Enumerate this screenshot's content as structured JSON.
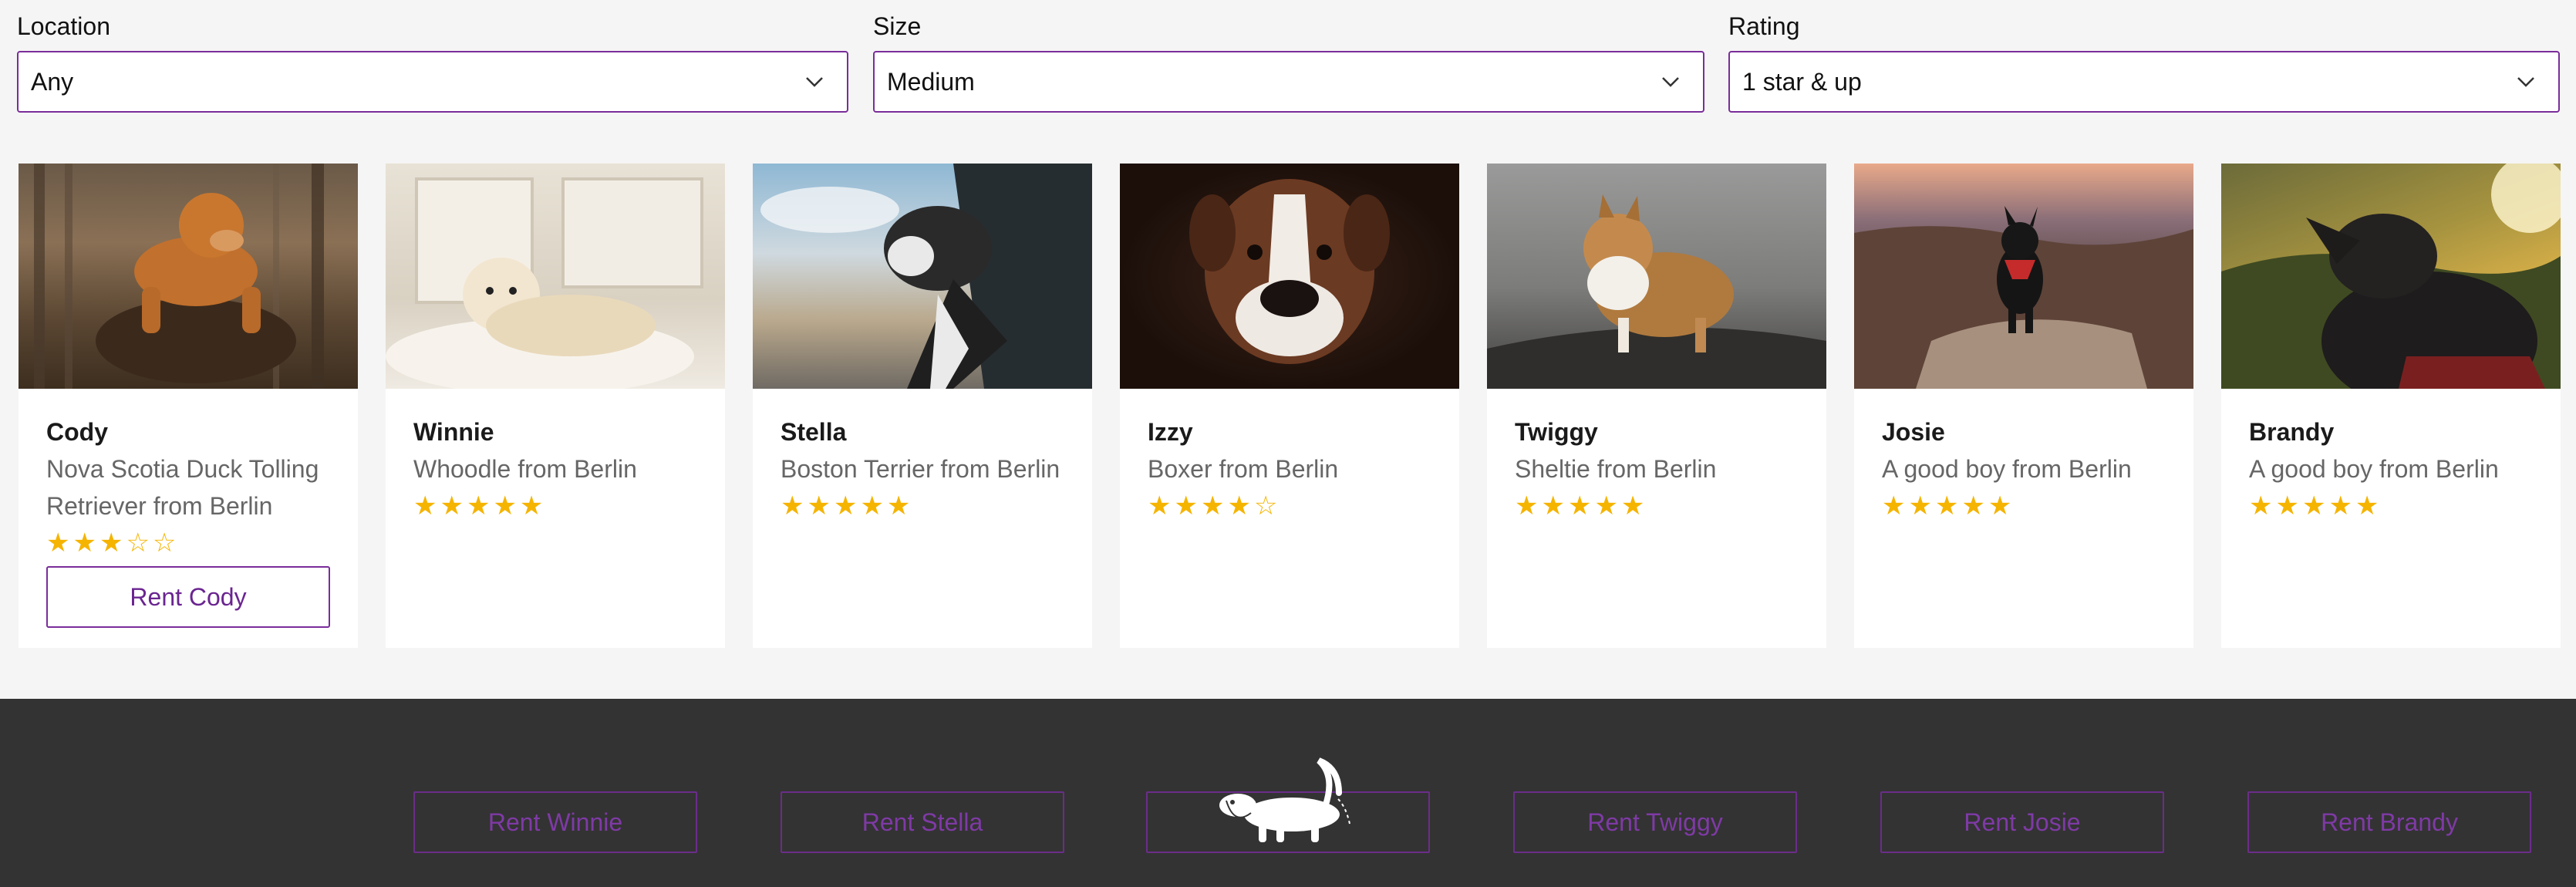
{
  "filters": [
    {
      "label": "Location",
      "value": "Any"
    },
    {
      "label": "Size",
      "value": "Medium"
    },
    {
      "label": "Rating",
      "value": "1 star & up"
    }
  ],
  "cards": [
    {
      "name": "Cody",
      "desc": "Nova Scotia Duck Tolling Retriever from Berlin",
      "stars": "★★★☆☆",
      "rating": 3,
      "rent_label": "Rent Cody",
      "photo": "dog-in-forest-photo"
    },
    {
      "name": "Winnie",
      "desc": "Whoodle from Berlin",
      "stars": "★★★★★",
      "rating": 5,
      "photo": "dog-on-bed-photo"
    },
    {
      "name": "Stella",
      "desc": "Boston Terrier from Berlin",
      "stars": "★★★★★",
      "rating": 5,
      "photo": "dog-in-car-window-photo"
    },
    {
      "name": "Izzy",
      "desc": "Boxer from Berlin",
      "stars": "★★★★☆",
      "rating": 4,
      "photo": "boxer-portrait-photo"
    },
    {
      "name": "Twiggy",
      "desc": "Sheltie from Berlin",
      "stars": "★★★★★",
      "rating": 5,
      "photo": "sheltie-on-rock-photo"
    },
    {
      "name": "Josie",
      "desc": "A good boy from Berlin",
      "stars": "★★★★★",
      "rating": 5,
      "photo": "dog-on-canyon-photo"
    },
    {
      "name": "Brandy",
      "desc": "A good boy from Berlin",
      "stars": "★★★★★",
      "rating": 5,
      "photo": "dog-at-sunset-photo"
    }
  ],
  "footer": {
    "buttons": [
      "Rent Winnie",
      "Rent Stella",
      "",
      "Rent Twiggy",
      "Rent Josie",
      "Rent Brandy"
    ],
    "logo": "dachshund-icon"
  },
  "colors": {
    "accent": "#7a2d9a",
    "star": "#f5b400",
    "footer_bg": "#333333",
    "page_bg": "#f5f5f5"
  }
}
